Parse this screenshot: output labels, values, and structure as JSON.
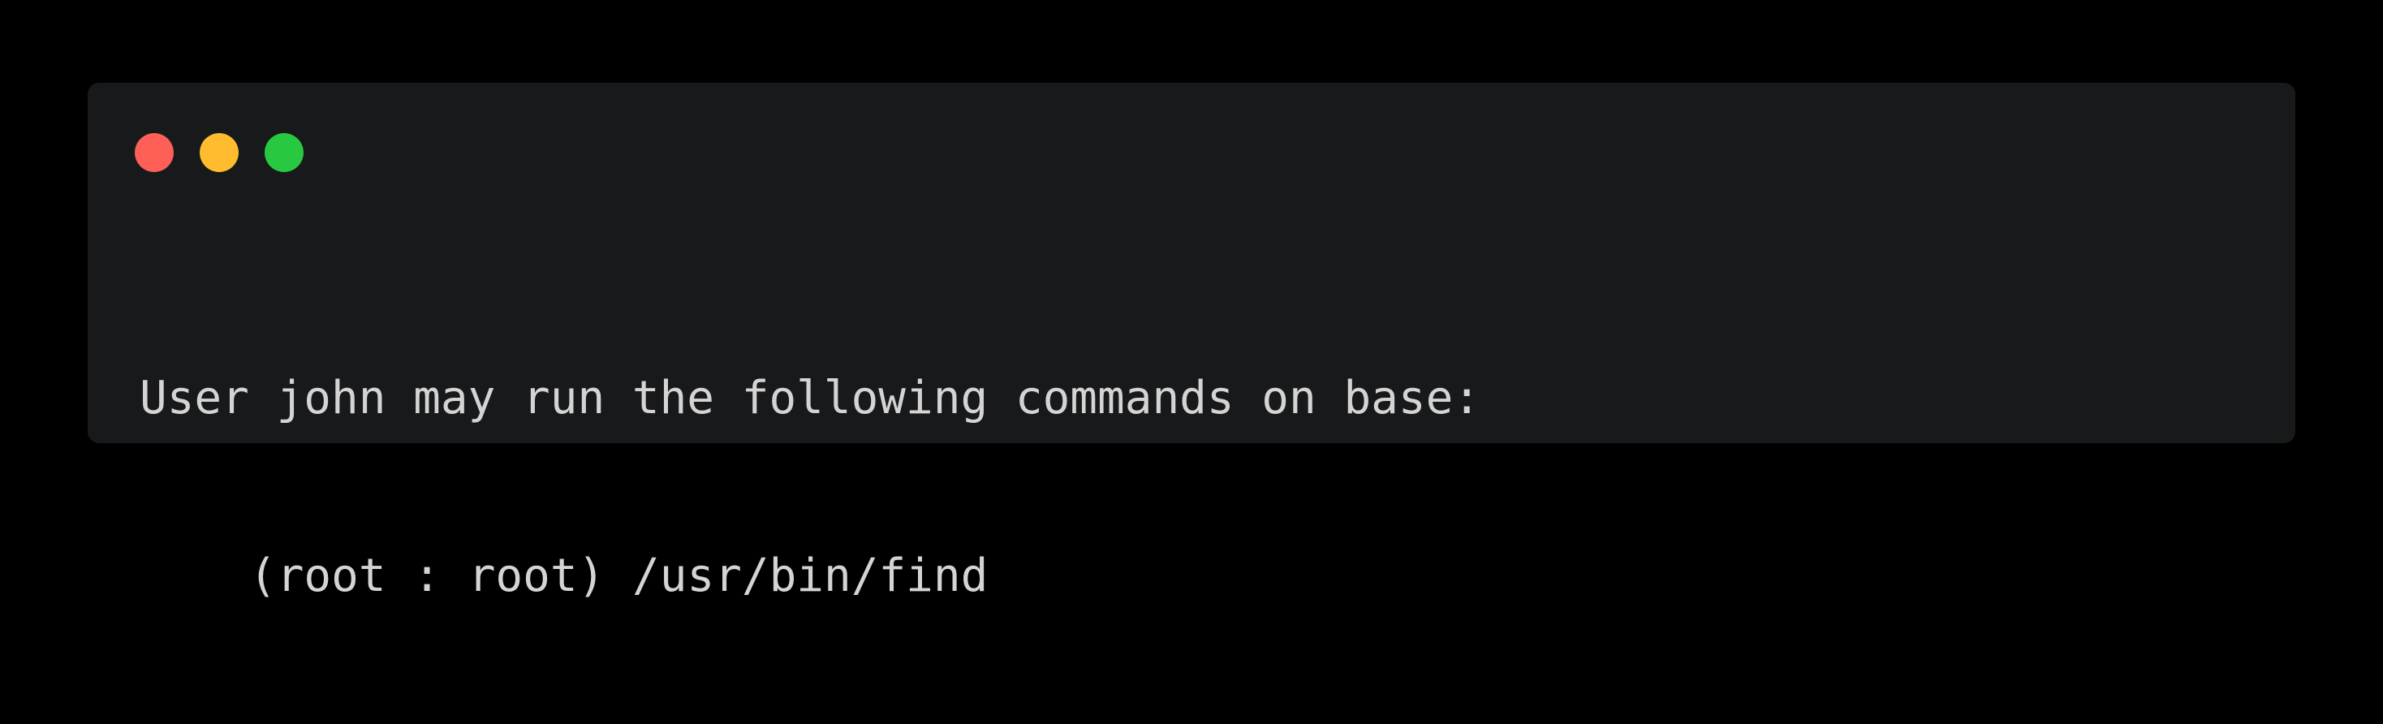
{
  "window": {
    "controls": [
      {
        "name": "close",
        "color": "#fe5f57"
      },
      {
        "name": "minimize",
        "color": "#febc2e"
      },
      {
        "name": "maximize",
        "color": "#28c840"
      }
    ],
    "background": "#18191b"
  },
  "terminal": {
    "text_color": "#d4d4d4",
    "lines": [
      "User john may run the following commands on base:",
      "(root : root) /usr/bin/find"
    ]
  }
}
